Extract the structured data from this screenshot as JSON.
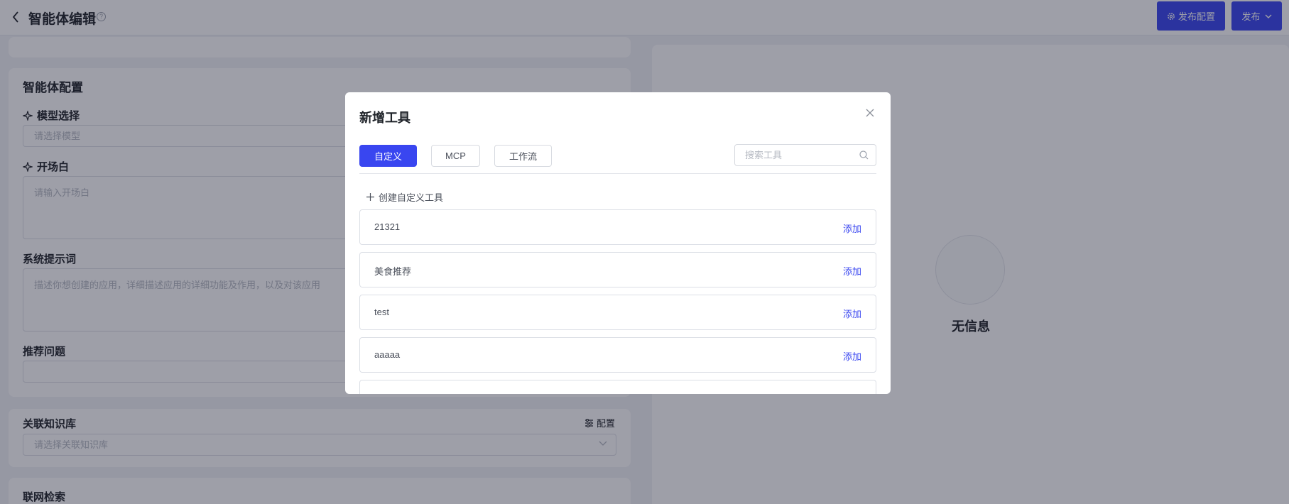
{
  "header": {
    "title": "智能体编辑",
    "help_icon": "?",
    "config_button": "发布配置",
    "publish_button": "发布"
  },
  "config": {
    "section_title": "智能体配置",
    "model_label": "模型选择",
    "model_placeholder": "请选择模型",
    "opening_label": "开场白",
    "opening_placeholder": "请输入开场白",
    "system_label": "系统提示词",
    "system_placeholder": "描述你想创建的应用，详细描述应用的详细功能及作用，以及对该应用",
    "questions_label": "推荐问题"
  },
  "knowledge": {
    "title": "关联知识库",
    "config_link": "配置",
    "placeholder": "请选择关联知识库"
  },
  "web": {
    "title": "联网检索"
  },
  "preview": {
    "empty_text": "无信息"
  },
  "modal": {
    "title": "新增工具",
    "tabs": [
      "自定义",
      "MCP",
      "工作流"
    ],
    "search_placeholder": "搜索工具",
    "create_label": "创建自定义工具",
    "add_label": "添加",
    "tools": [
      {
        "name": "21321"
      },
      {
        "name": "美食推荐"
      },
      {
        "name": "test"
      },
      {
        "name": "aaaaa"
      }
    ]
  },
  "colors": {
    "accent": "#3946f0",
    "overlay": "rgba(23,27,48,0.42)"
  }
}
